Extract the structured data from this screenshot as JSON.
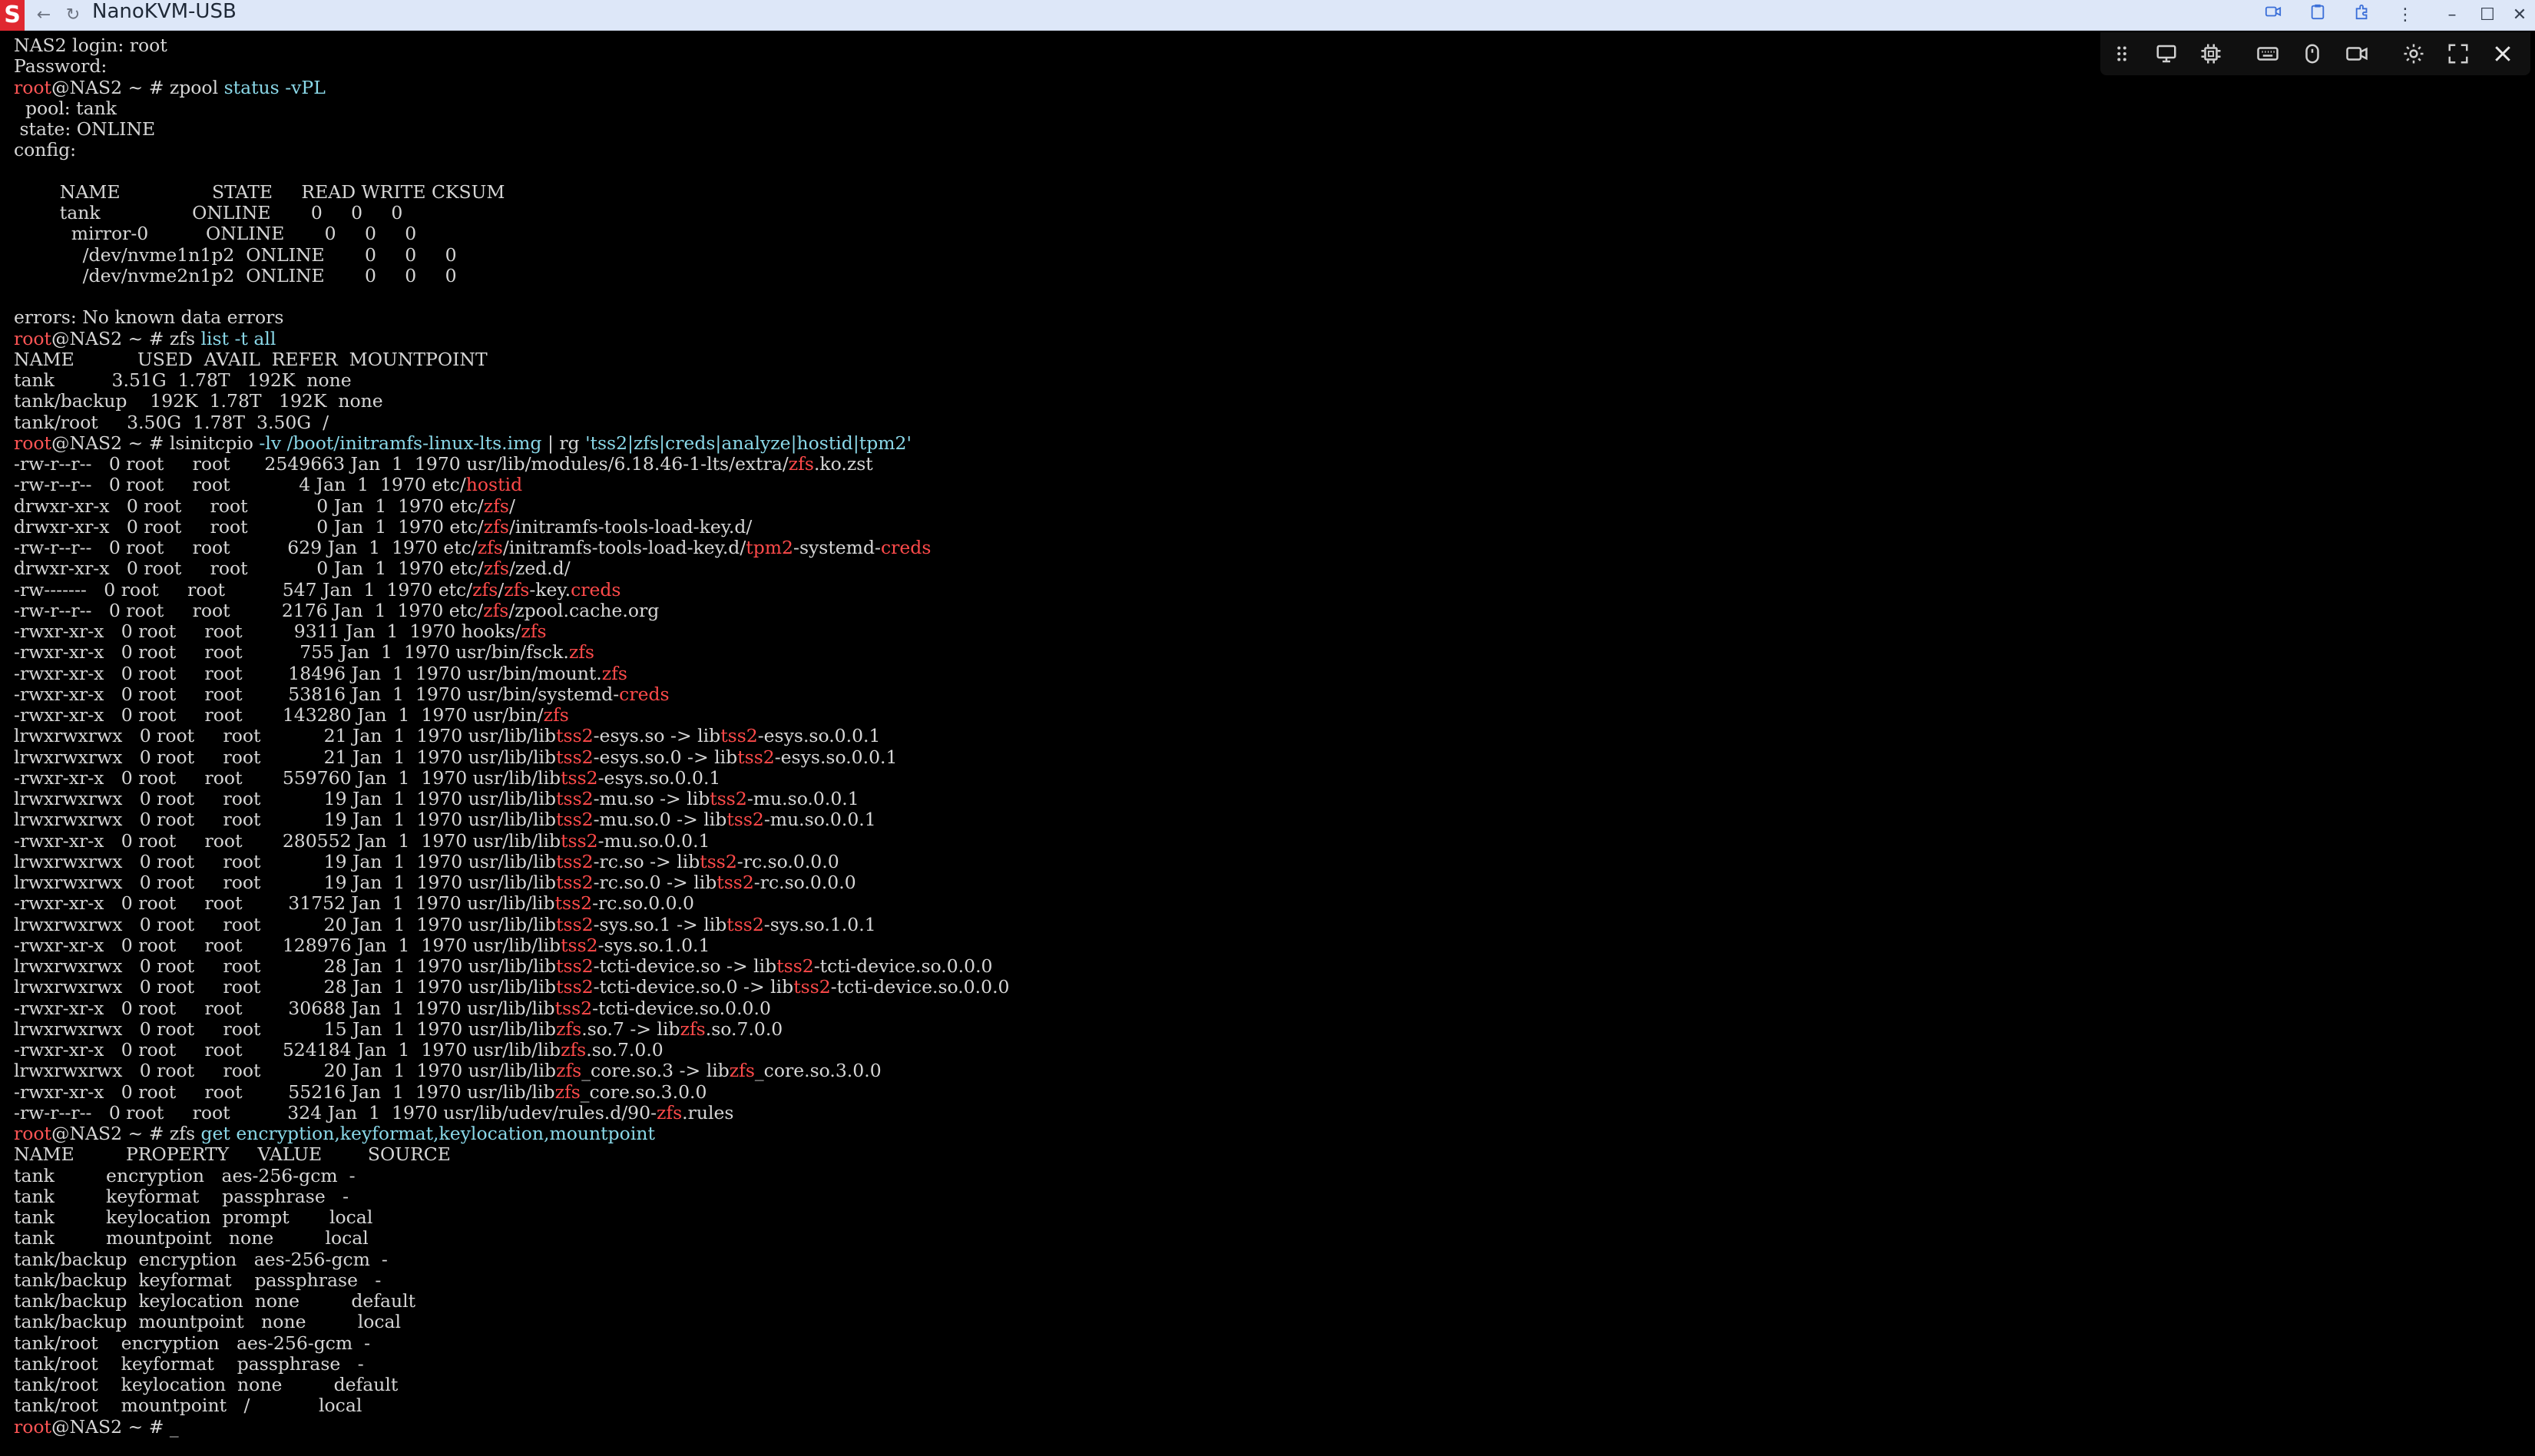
{
  "window": {
    "title": "NanoKVM-USB",
    "logo": "S",
    "nav": [
      "back-arrow-icon",
      "reload-icon"
    ],
    "right_icons": [
      "camera-icon",
      "clipboard-icon",
      "extension-icon",
      "more-vert-icon"
    ],
    "controls": [
      "minimize-icon",
      "maximize-icon",
      "close-icon"
    ]
  },
  "kvm_toolbar": {
    "icons": [
      "drag-handle-icon",
      "monitor-icon",
      "chip-icon",
      "keyboard-icon",
      "mouse-icon",
      "video-record-icon",
      "settings-gear-icon",
      "fullscreen-icon",
      "close-icon"
    ]
  },
  "prompt": {
    "user": "root",
    "host": "@NAS2",
    "sep": " ~ # "
  },
  "terminal": {
    "lines": [
      [
        {
          "t": "NAS2 login: root"
        }
      ],
      [
        {
          "t": "Password:"
        }
      ],
      [
        {
          "t": "root",
          "c": "pr-user"
        },
        {
          "t": "@NAS2 ~ # ",
          "c": "pr-host"
        },
        {
          "t": "zpool "
        },
        {
          "t": "status -vPL",
          "c": "cyan"
        }
      ],
      [
        {
          "t": "  pool: tank"
        }
      ],
      [
        {
          "t": " state: ONLINE"
        }
      ],
      [
        {
          "t": "config:"
        }
      ],
      [
        {
          "t": ""
        }
      ],
      [
        {
          "t": "        NAME                STATE     READ WRITE CKSUM"
        }
      ],
      [
        {
          "t": "        tank                ONLINE       0     0     0"
        }
      ],
      [
        {
          "t": "          mirror-0          ONLINE       0     0     0"
        }
      ],
      [
        {
          "t": "            /dev/nvme1n1p2  ONLINE       0     0     0"
        }
      ],
      [
        {
          "t": "            /dev/nvme2n1p2  ONLINE       0     0     0"
        }
      ],
      [
        {
          "t": ""
        }
      ],
      [
        {
          "t": "errors: No known data errors"
        }
      ],
      [
        {
          "t": "root",
          "c": "pr-user"
        },
        {
          "t": "@NAS2 ~ # ",
          "c": "pr-host"
        },
        {
          "t": "zfs "
        },
        {
          "t": "list -t all",
          "c": "cyan"
        }
      ],
      [
        {
          "t": "NAME           USED  AVAIL  REFER  MOUNTPOINT"
        }
      ],
      [
        {
          "t": "tank          3.51G  1.78T   192K  none"
        }
      ],
      [
        {
          "t": "tank/backup    192K  1.78T   192K  none"
        }
      ],
      [
        {
          "t": "tank/root     3.50G  1.78T  3.50G  /"
        }
      ],
      [
        {
          "t": "root",
          "c": "pr-user"
        },
        {
          "t": "@NAS2 ~ # ",
          "c": "pr-host"
        },
        {
          "t": "lsinitcpio "
        },
        {
          "t": "-lv /boot/initramfs-linux-lts.img",
          "c": "cyan"
        },
        {
          "t": " | rg "
        },
        {
          "t": "'tss2|zfs|creds|analyze|hostid|tpm2'",
          "c": "cyan"
        }
      ],
      [
        {
          "t": "-rw-r--r--   0 root     root      2549663 Jan  1  1970 usr/lib/modules/6.18.46-1-lts/extra/"
        },
        {
          "t": "zfs",
          "c": "red"
        },
        {
          "t": ".ko.zst"
        }
      ],
      [
        {
          "t": "-rw-r--r--   0 root     root            4 Jan  1  1970 etc/"
        },
        {
          "t": "hostid",
          "c": "red"
        }
      ],
      [
        {
          "t": "drwxr-xr-x   0 root     root            0 Jan  1  1970 etc/"
        },
        {
          "t": "zfs",
          "c": "red"
        },
        {
          "t": "/"
        }
      ],
      [
        {
          "t": "drwxr-xr-x   0 root     root            0 Jan  1  1970 etc/"
        },
        {
          "t": "zfs",
          "c": "red"
        },
        {
          "t": "/initramfs-tools-load-key.d/"
        }
      ],
      [
        {
          "t": "-rw-r--r--   0 root     root          629 Jan  1  1970 etc/"
        },
        {
          "t": "zfs",
          "c": "red"
        },
        {
          "t": "/initramfs-tools-load-key.d/"
        },
        {
          "t": "tpm2",
          "c": "red"
        },
        {
          "t": "-systemd-"
        },
        {
          "t": "creds",
          "c": "red"
        }
      ],
      [
        {
          "t": "drwxr-xr-x   0 root     root            0 Jan  1  1970 etc/"
        },
        {
          "t": "zfs",
          "c": "red"
        },
        {
          "t": "/zed.d/"
        }
      ],
      [
        {
          "t": "-rw-------   0 root     root          547 Jan  1  1970 etc/"
        },
        {
          "t": "zfs",
          "c": "red"
        },
        {
          "t": "/"
        },
        {
          "t": "zfs",
          "c": "red"
        },
        {
          "t": "-key."
        },
        {
          "t": "creds",
          "c": "red"
        }
      ],
      [
        {
          "t": "-rw-r--r--   0 root     root         2176 Jan  1  1970 etc/"
        },
        {
          "t": "zfs",
          "c": "red"
        },
        {
          "t": "/zpool.cache.org"
        }
      ],
      [
        {
          "t": "-rwxr-xr-x   0 root     root         9311 Jan  1  1970 hooks/"
        },
        {
          "t": "zfs",
          "c": "red"
        }
      ],
      [
        {
          "t": "-rwxr-xr-x   0 root     root          755 Jan  1  1970 usr/bin/fsck."
        },
        {
          "t": "zfs",
          "c": "red"
        }
      ],
      [
        {
          "t": "-rwxr-xr-x   0 root     root        18496 Jan  1  1970 usr/bin/mount."
        },
        {
          "t": "zfs",
          "c": "red"
        }
      ],
      [
        {
          "t": "-rwxr-xr-x   0 root     root        53816 Jan  1  1970 usr/bin/systemd-"
        },
        {
          "t": "creds",
          "c": "red"
        }
      ],
      [
        {
          "t": "-rwxr-xr-x   0 root     root       143280 Jan  1  1970 usr/bin/"
        },
        {
          "t": "zfs",
          "c": "red"
        }
      ],
      [
        {
          "t": "lrwxrwxrwx   0 root     root           21 Jan  1  1970 usr/lib/lib"
        },
        {
          "t": "tss2",
          "c": "red"
        },
        {
          "t": "-esys.so -> lib"
        },
        {
          "t": "tss2",
          "c": "red"
        },
        {
          "t": "-esys.so.0.0.1"
        }
      ],
      [
        {
          "t": "lrwxrwxrwx   0 root     root           21 Jan  1  1970 usr/lib/lib"
        },
        {
          "t": "tss2",
          "c": "red"
        },
        {
          "t": "-esys.so.0 -> lib"
        },
        {
          "t": "tss2",
          "c": "red"
        },
        {
          "t": "-esys.so.0.0.1"
        }
      ],
      [
        {
          "t": "-rwxr-xr-x   0 root     root       559760 Jan  1  1970 usr/lib/lib"
        },
        {
          "t": "tss2",
          "c": "red"
        },
        {
          "t": "-esys.so.0.0.1"
        }
      ],
      [
        {
          "t": "lrwxrwxrwx   0 root     root           19 Jan  1  1970 usr/lib/lib"
        },
        {
          "t": "tss2",
          "c": "red"
        },
        {
          "t": "-mu.so -> lib"
        },
        {
          "t": "tss2",
          "c": "red"
        },
        {
          "t": "-mu.so.0.0.1"
        }
      ],
      [
        {
          "t": "lrwxrwxrwx   0 root     root           19 Jan  1  1970 usr/lib/lib"
        },
        {
          "t": "tss2",
          "c": "red"
        },
        {
          "t": "-mu.so.0 -> lib"
        },
        {
          "t": "tss2",
          "c": "red"
        },
        {
          "t": "-mu.so.0.0.1"
        }
      ],
      [
        {
          "t": "-rwxr-xr-x   0 root     root       280552 Jan  1  1970 usr/lib/lib"
        },
        {
          "t": "tss2",
          "c": "red"
        },
        {
          "t": "-mu.so.0.0.1"
        }
      ],
      [
        {
          "t": "lrwxrwxrwx   0 root     root           19 Jan  1  1970 usr/lib/lib"
        },
        {
          "t": "tss2",
          "c": "red"
        },
        {
          "t": "-rc.so -> lib"
        },
        {
          "t": "tss2",
          "c": "red"
        },
        {
          "t": "-rc.so.0.0.0"
        }
      ],
      [
        {
          "t": "lrwxrwxrwx   0 root     root           19 Jan  1  1970 usr/lib/lib"
        },
        {
          "t": "tss2",
          "c": "red"
        },
        {
          "t": "-rc.so.0 -> lib"
        },
        {
          "t": "tss2",
          "c": "red"
        },
        {
          "t": "-rc.so.0.0.0"
        }
      ],
      [
        {
          "t": "-rwxr-xr-x   0 root     root        31752 Jan  1  1970 usr/lib/lib"
        },
        {
          "t": "tss2",
          "c": "red"
        },
        {
          "t": "-rc.so.0.0.0"
        }
      ],
      [
        {
          "t": "lrwxrwxrwx   0 root     root           20 Jan  1  1970 usr/lib/lib"
        },
        {
          "t": "tss2",
          "c": "red"
        },
        {
          "t": "-sys.so.1 -> lib"
        },
        {
          "t": "tss2",
          "c": "red"
        },
        {
          "t": "-sys.so.1.0.1"
        }
      ],
      [
        {
          "t": "-rwxr-xr-x   0 root     root       128976 Jan  1  1970 usr/lib/lib"
        },
        {
          "t": "tss2",
          "c": "red"
        },
        {
          "t": "-sys.so.1.0.1"
        }
      ],
      [
        {
          "t": "lrwxrwxrwx   0 root     root           28 Jan  1  1970 usr/lib/lib"
        },
        {
          "t": "tss2",
          "c": "red"
        },
        {
          "t": "-tcti-device.so -> lib"
        },
        {
          "t": "tss2",
          "c": "red"
        },
        {
          "t": "-tcti-device.so.0.0.0"
        }
      ],
      [
        {
          "t": "lrwxrwxrwx   0 root     root           28 Jan  1  1970 usr/lib/lib"
        },
        {
          "t": "tss2",
          "c": "red"
        },
        {
          "t": "-tcti-device.so.0 -> lib"
        },
        {
          "t": "tss2",
          "c": "red"
        },
        {
          "t": "-tcti-device.so.0.0.0"
        }
      ],
      [
        {
          "t": "-rwxr-xr-x   0 root     root        30688 Jan  1  1970 usr/lib/lib"
        },
        {
          "t": "tss2",
          "c": "red"
        },
        {
          "t": "-tcti-device.so.0.0.0"
        }
      ],
      [
        {
          "t": "lrwxrwxrwx   0 root     root           15 Jan  1  1970 usr/lib/lib"
        },
        {
          "t": "zfs",
          "c": "red"
        },
        {
          "t": ".so.7 -> lib"
        },
        {
          "t": "zfs",
          "c": "red"
        },
        {
          "t": ".so.7.0.0"
        }
      ],
      [
        {
          "t": "-rwxr-xr-x   0 root     root       524184 Jan  1  1970 usr/lib/lib"
        },
        {
          "t": "zfs",
          "c": "red"
        },
        {
          "t": ".so.7.0.0"
        }
      ],
      [
        {
          "t": "lrwxrwxrwx   0 root     root           20 Jan  1  1970 usr/lib/lib"
        },
        {
          "t": "zfs",
          "c": "red"
        },
        {
          "t": "_core.so.3 -> lib"
        },
        {
          "t": "zfs",
          "c": "red"
        },
        {
          "t": "_core.so.3.0.0"
        }
      ],
      [
        {
          "t": "-rwxr-xr-x   0 root     root        55216 Jan  1  1970 usr/lib/lib"
        },
        {
          "t": "zfs",
          "c": "red"
        },
        {
          "t": "_core.so.3.0.0"
        }
      ],
      [
        {
          "t": "-rw-r--r--   0 root     root          324 Jan  1  1970 usr/lib/udev/rules.d/90-"
        },
        {
          "t": "zfs",
          "c": "red"
        },
        {
          "t": ".rules"
        }
      ],
      [
        {
          "t": "root",
          "c": "pr-user"
        },
        {
          "t": "@NAS2 ~ # ",
          "c": "pr-host"
        },
        {
          "t": "zfs "
        },
        {
          "t": "get encryption,keyformat,keylocation,mountpoint",
          "c": "cyan"
        }
      ],
      [
        {
          "t": "NAME         PROPERTY     VALUE        SOURCE"
        }
      ],
      [
        {
          "t": "tank         encryption   aes-256-gcm  -"
        }
      ],
      [
        {
          "t": "tank         keyformat    passphrase   -"
        }
      ],
      [
        {
          "t": "tank         keylocation  prompt       local"
        }
      ],
      [
        {
          "t": "tank         mountpoint   none         local"
        }
      ],
      [
        {
          "t": "tank/backup  encryption   aes-256-gcm  -"
        }
      ],
      [
        {
          "t": "tank/backup  keyformat    passphrase   -"
        }
      ],
      [
        {
          "t": "tank/backup  keylocation  none         default"
        }
      ],
      [
        {
          "t": "tank/backup  mountpoint   none         local"
        }
      ],
      [
        {
          "t": "tank/root    encryption   aes-256-gcm  -"
        }
      ],
      [
        {
          "t": "tank/root    keyformat    passphrase   -"
        }
      ],
      [
        {
          "t": "tank/root    keylocation  none         default"
        }
      ],
      [
        {
          "t": "tank/root    mountpoint   /            local"
        }
      ],
      [
        {
          "t": "root",
          "c": "pr-user"
        },
        {
          "t": "@NAS2 ~ # ",
          "c": "pr-host"
        },
        {
          "t": "_",
          "c": "cursor"
        }
      ]
    ]
  }
}
